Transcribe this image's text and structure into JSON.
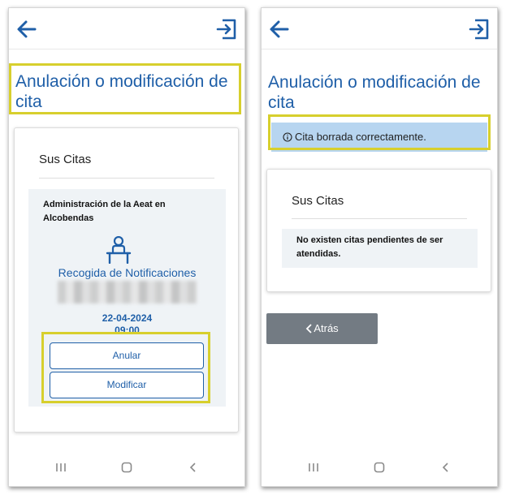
{
  "left_screen": {
    "title": "Anulación o modificación de cita",
    "card": {
      "title": "Sus Citas",
      "appointment": {
        "office": "Administración de la Aeat en Alcobendas",
        "service": "Recogida de Notificaciones",
        "date": "22-04-2024",
        "time": "09:00"
      },
      "cancel_label": "Anular",
      "modify_label": "Modificar"
    }
  },
  "right_screen": {
    "title": "Anulación o modificación de cita",
    "banner": "Cita borrada correctamente.",
    "card": {
      "title": "Sus Citas",
      "empty_message": "No existen citas pendientes de ser atendidas."
    },
    "back_label": "Atrás"
  },
  "icons": {
    "back": "arrow-left-icon",
    "exit": "exit-icon",
    "desk": "desk-person-icon",
    "info": "info-circle-icon",
    "chevron": "chevron-left-icon",
    "nav_recent": "recent-apps-icon",
    "nav_home": "home-icon",
    "nav_back": "nav-back-icon"
  },
  "colors": {
    "accent": "#1f5fa8",
    "highlight": "#d7cf2d",
    "banner": "#b7d5f0",
    "panel": "#eff3f6",
    "button_gray": "#737b83"
  }
}
